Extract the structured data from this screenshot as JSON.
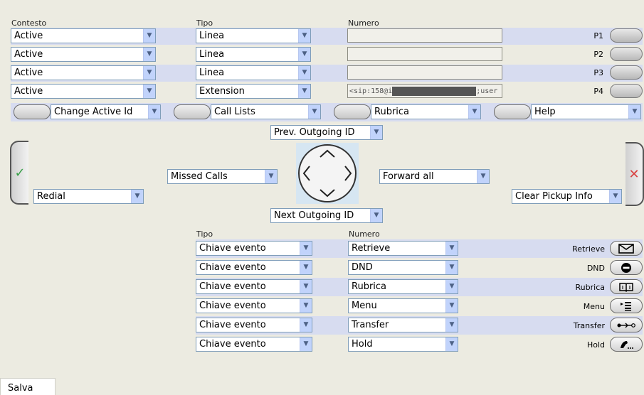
{
  "headers": {
    "contesto": "Contesto",
    "tipo": "Tipo",
    "numero": "Numero"
  },
  "lines": [
    {
      "contesto": "Active",
      "tipo": "Linea",
      "numero": "",
      "key": "P1"
    },
    {
      "contesto": "Active",
      "tipo": "Linea",
      "numero": "",
      "key": "P2"
    },
    {
      "contesto": "Active",
      "tipo": "Linea",
      "numero": "",
      "key": "P3"
    },
    {
      "contesto": "Active",
      "tipo": "Extension",
      "numero": "<sip:158@i",
      "numero_tail": ";user",
      "key": "P4"
    }
  ],
  "softkeys": [
    "Change Active Id",
    "Call Lists",
    "Rubrica",
    "Help"
  ],
  "nav": {
    "up": "Prev. Outgoing ID",
    "down": "Next Outgoing ID",
    "left": "Missed Calls",
    "right": "Forward all",
    "accept": "Redial",
    "cancel": "Clear Pickup Info"
  },
  "colors": {
    "accept": "#3aa04a",
    "cancel": "#d94040",
    "band": "#d7dcf0",
    "background": "#ecebe1"
  },
  "function_headers": {
    "tipo": "Tipo",
    "numero": "Numero"
  },
  "function_keys": [
    {
      "tipo": "Chiave evento",
      "numero": "Retrieve",
      "label": "Retrieve",
      "icon": "envelope-icon"
    },
    {
      "tipo": "Chiave evento",
      "numero": "DND",
      "label": "DND",
      "icon": "no-entry-icon"
    },
    {
      "tipo": "Chiave evento",
      "numero": "Rubrica",
      "label": "Rubrica",
      "icon": "book-icon"
    },
    {
      "tipo": "Chiave evento",
      "numero": "Menu",
      "label": "Menu",
      "icon": "menu-icon"
    },
    {
      "tipo": "Chiave evento",
      "numero": "Transfer",
      "label": "Transfer",
      "icon": "transfer-icon"
    },
    {
      "tipo": "Chiave evento",
      "numero": "Hold",
      "label": "Hold",
      "icon": "hold-handset-icon"
    }
  ],
  "save_label": "Salva"
}
